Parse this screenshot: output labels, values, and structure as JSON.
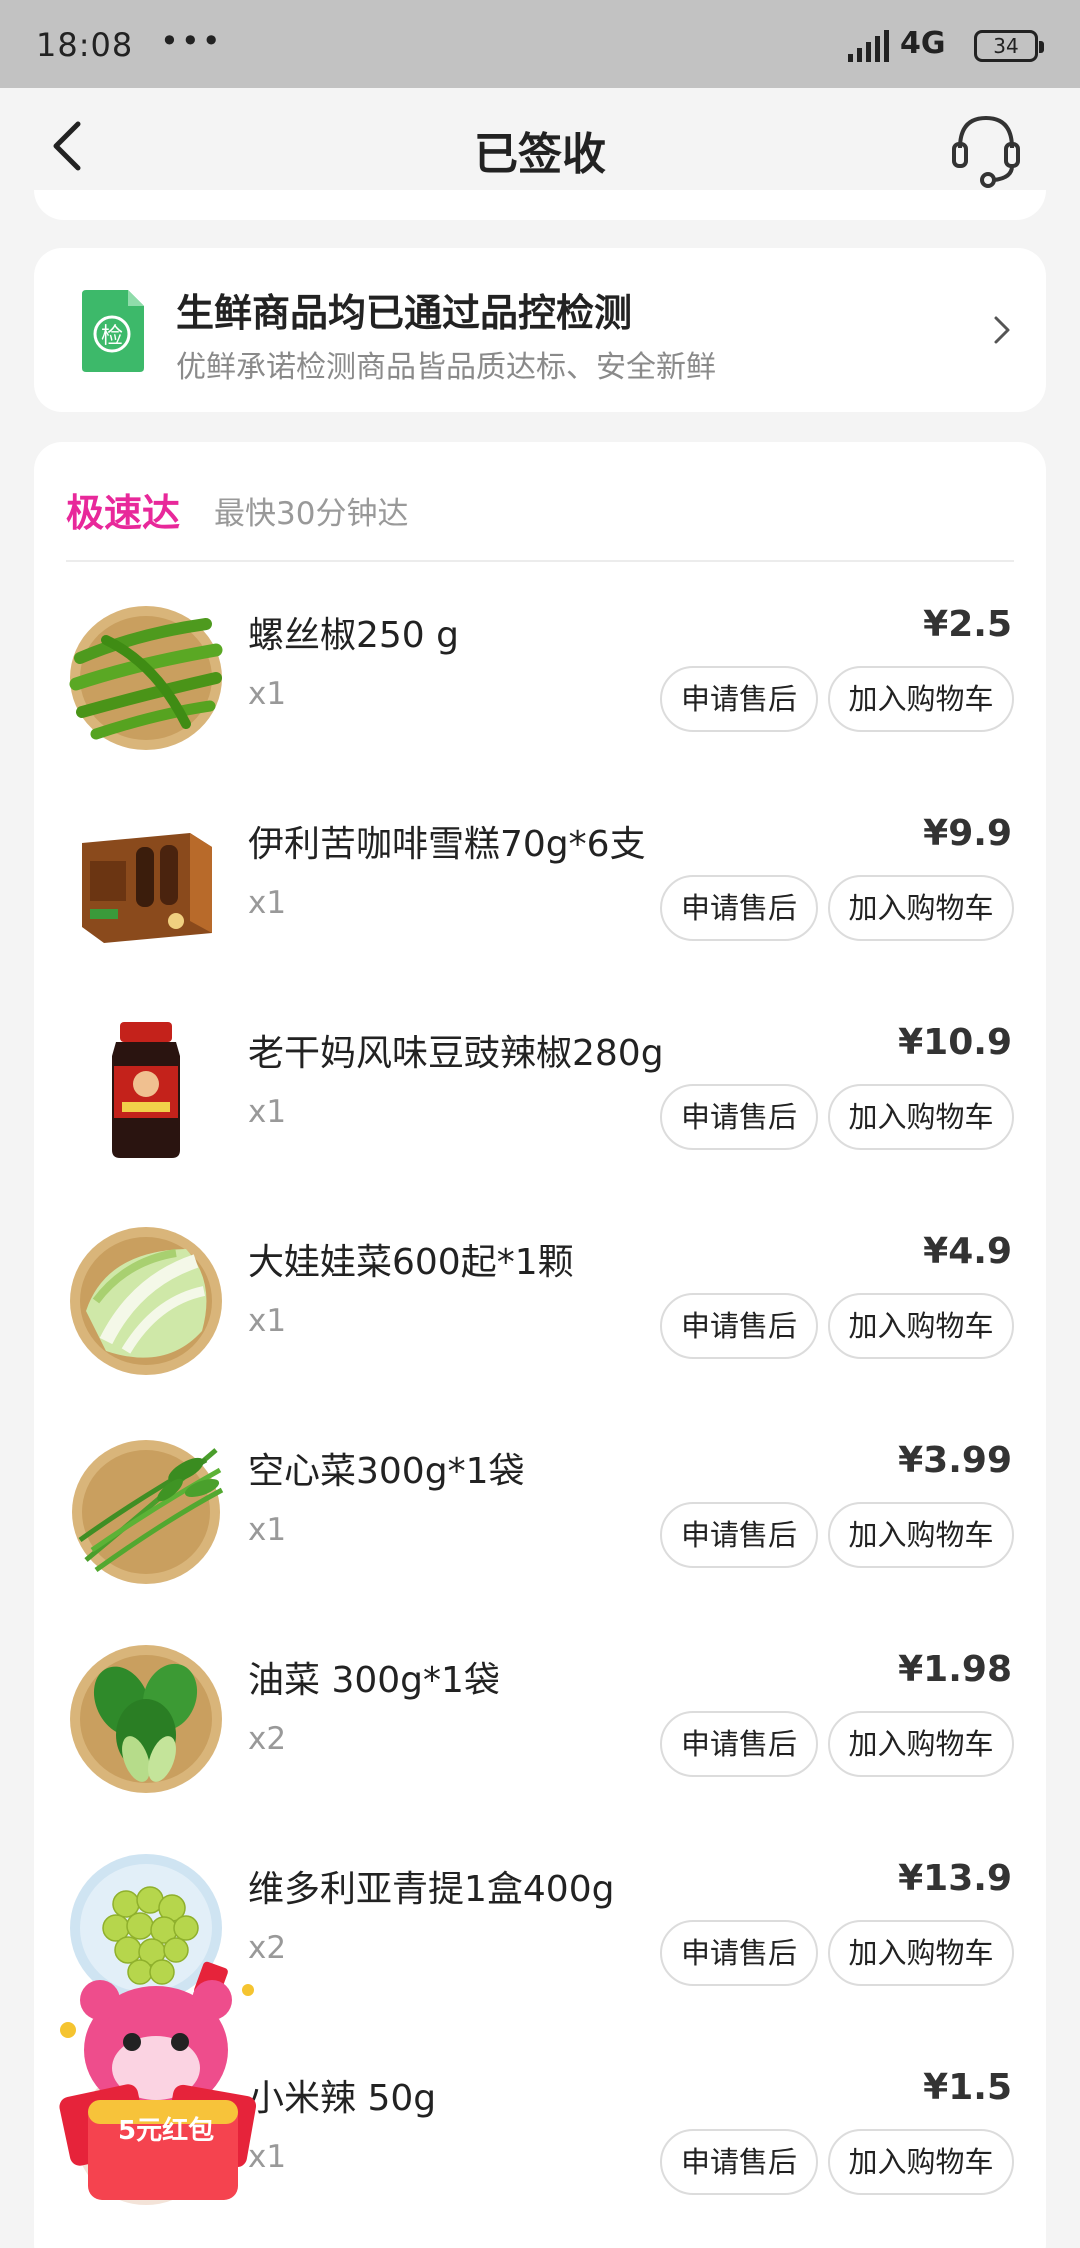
{
  "status_bar": {
    "time": "18:08",
    "dots": "•••",
    "network": "4G",
    "battery": "34"
  },
  "nav": {
    "title": "已签收"
  },
  "quality_check": {
    "icon_label": "检",
    "title": "生鲜商品均已通过品控检测",
    "subtitle": "优鲜承诺检测商品皆品质达标、安全新鲜"
  },
  "order": {
    "brand": "极速达",
    "brand_subtitle": "最快30分钟达",
    "after_sale_label": "申请售后",
    "add_cart_label": "加入购物车",
    "items": [
      {
        "name": "螺丝椒250 g",
        "price": "¥2.5",
        "qty": "x1",
        "image": "green-peppers"
      },
      {
        "name": "伊利苦咖啡雪糕70g*6支",
        "price": "¥9.9",
        "qty": "x1",
        "image": "ice-cream-box"
      },
      {
        "name": "老干妈风味豆豉辣椒280g",
        "price": "¥10.9",
        "qty": "x1",
        "image": "chili-sauce-jar"
      },
      {
        "name": "大娃娃菜600起*1颗",
        "price": "¥4.9",
        "qty": "x1",
        "image": "napa-cabbage"
      },
      {
        "name": "空心菜300g*1袋",
        "price": "¥3.99",
        "qty": "x1",
        "image": "water-spinach"
      },
      {
        "name": "油菜 300g*1袋",
        "price": "¥1.98",
        "qty": "x2",
        "image": "bok-choy"
      },
      {
        "name": "维多利亚青提1盒400g",
        "price": "¥13.9",
        "qty": "x2",
        "image": "green-grapes"
      },
      {
        "name": "小米辣  50g",
        "price": "¥1.5",
        "qty": "x1",
        "image": "red-chili"
      }
    ]
  },
  "red_packet": {
    "label": "5元红包"
  },
  "colors": {
    "brand": "#e8289a",
    "status_bar": "#c2c2c2",
    "background": "#f4f4f4"
  }
}
